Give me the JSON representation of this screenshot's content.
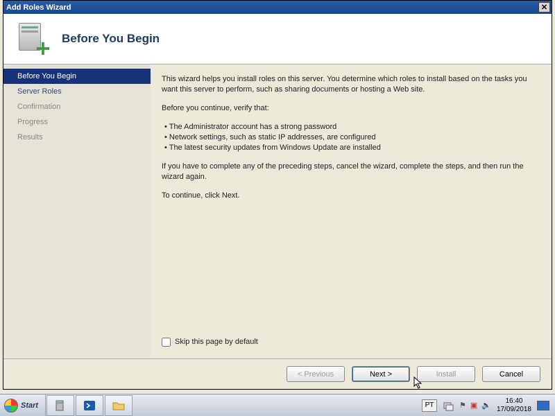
{
  "window": {
    "title": "Add Roles Wizard",
    "close_glyph": "✕"
  },
  "header": {
    "title": "Before You Begin"
  },
  "sidebar": {
    "items": [
      {
        "label": "Before You Begin",
        "selected": true
      },
      {
        "label": "Server Roles",
        "selected": false
      },
      {
        "label": "Confirmation",
        "selected": false,
        "dim": true
      },
      {
        "label": "Progress",
        "selected": false,
        "dim": true
      },
      {
        "label": "Results",
        "selected": false,
        "dim": true
      }
    ]
  },
  "content": {
    "intro": "This wizard helps you install roles on this server. You determine which roles to install based on the tasks you want this server to perform, such as sharing documents or hosting a Web site.",
    "verify_heading": "Before you continue, verify that:",
    "bullets": [
      "The Administrator account has a strong password",
      "Network settings, such as static IP addresses, are configured",
      "The latest security updates from Windows Update are installed"
    ],
    "preceding": "If you have to complete any of the preceding steps, cancel the wizard, complete the steps, and then run the wizard again.",
    "continue": "To continue, click Next.",
    "skip_label": "Skip this page by default"
  },
  "footer": {
    "previous": "< Previous",
    "next": "Next >",
    "install": "Install",
    "cancel": "Cancel"
  },
  "taskbar": {
    "start": "Start",
    "lang": "PT",
    "time": "16:40",
    "date": "17/09/2018"
  }
}
